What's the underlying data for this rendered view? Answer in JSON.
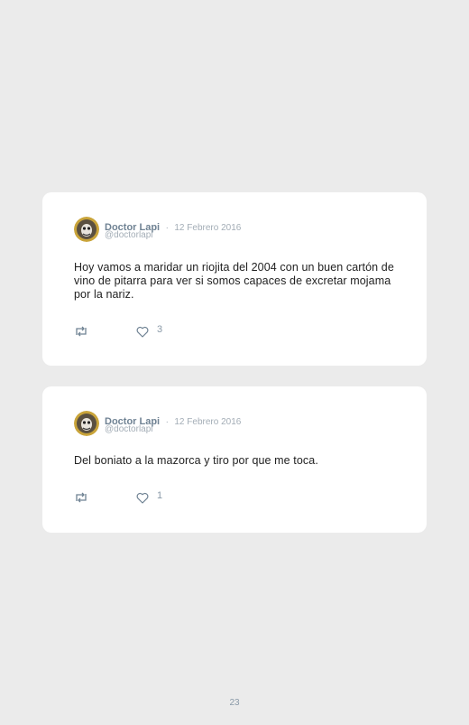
{
  "tweets": [
    {
      "author_name": "Doctor Lapi",
      "separator": "·",
      "date": "12 Febrero 2016",
      "handle": "@doctorlapi",
      "text": "Hoy vamos a maridar un riojita del 2004 con un buen cartón de vino de pitarra para ver si somos capaces de excretar mojama por la nariz.",
      "likes": "3"
    },
    {
      "author_name": "Doctor Lapi",
      "separator": "·",
      "date": "12 Febrero 2016",
      "handle": "@doctorlapi",
      "text": "Del boniato a la mazorca y tiro por que me toca.",
      "likes": "1"
    }
  ],
  "page_number": "23",
  "icons": {
    "retweet": "retweet-icon",
    "like": "heart-icon",
    "avatar": "avatar"
  },
  "colors": {
    "background": "#ebebeb",
    "card": "#ffffff",
    "name": "#6f8293",
    "muted": "#a3adb6",
    "text": "#222222"
  }
}
